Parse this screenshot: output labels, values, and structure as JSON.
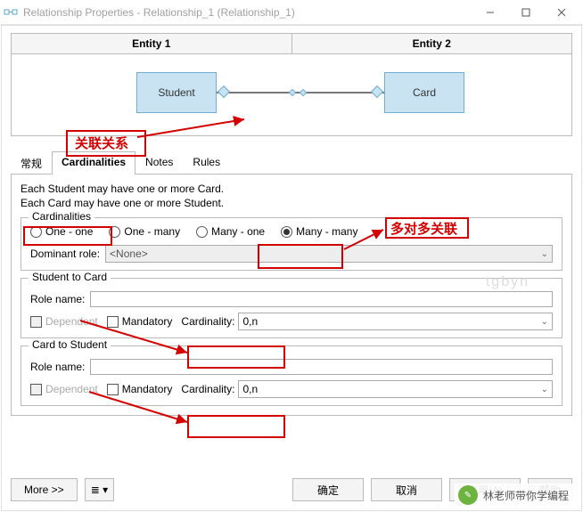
{
  "window": {
    "title": "Relationship Properties - Relationship_1 (Relationship_1)"
  },
  "entities": {
    "col1": "Entity 1",
    "col2": "Entity 2",
    "left_name": "Student",
    "right_name": "Card"
  },
  "tabs": {
    "general": "常规",
    "cardinalities": "Cardinalities",
    "notes": "Notes",
    "rules": "Rules"
  },
  "description": {
    "line1": "Each Student may have one or more Card.",
    "line2": "Each Card may have one or more Student."
  },
  "cardinalities_group": {
    "title": "Cardinalities",
    "opt1": "One - one",
    "opt2": "One - many",
    "opt3": "Many - one",
    "opt4": "Many - many",
    "dominant_label": "Dominant role:",
    "dominant_value": "<None>"
  },
  "s2c": {
    "title": "Student to Card",
    "role_label": "Role name:",
    "role_value": "",
    "dependent_label": "Dependent",
    "mandatory_label": "Mandatory",
    "card_label": "Cardinality:",
    "card_value": "0,n"
  },
  "c2s": {
    "title": "Card to Student",
    "role_label": "Role name:",
    "role_value": "",
    "dependent_label": "Dependent",
    "mandatory_label": "Mandatory",
    "card_label": "Cardinality:",
    "card_value": "0,n"
  },
  "buttons": {
    "more": "More >>",
    "ok": "确定",
    "cancel": "取消",
    "apply": "应用(A)",
    "help": "帮助"
  },
  "annotations": {
    "rel_label": "关联关系",
    "m2m_label": "多对多关联"
  },
  "watermark": {
    "bubble_text": "林老师带你学编程",
    "faded": "tgbyn"
  }
}
